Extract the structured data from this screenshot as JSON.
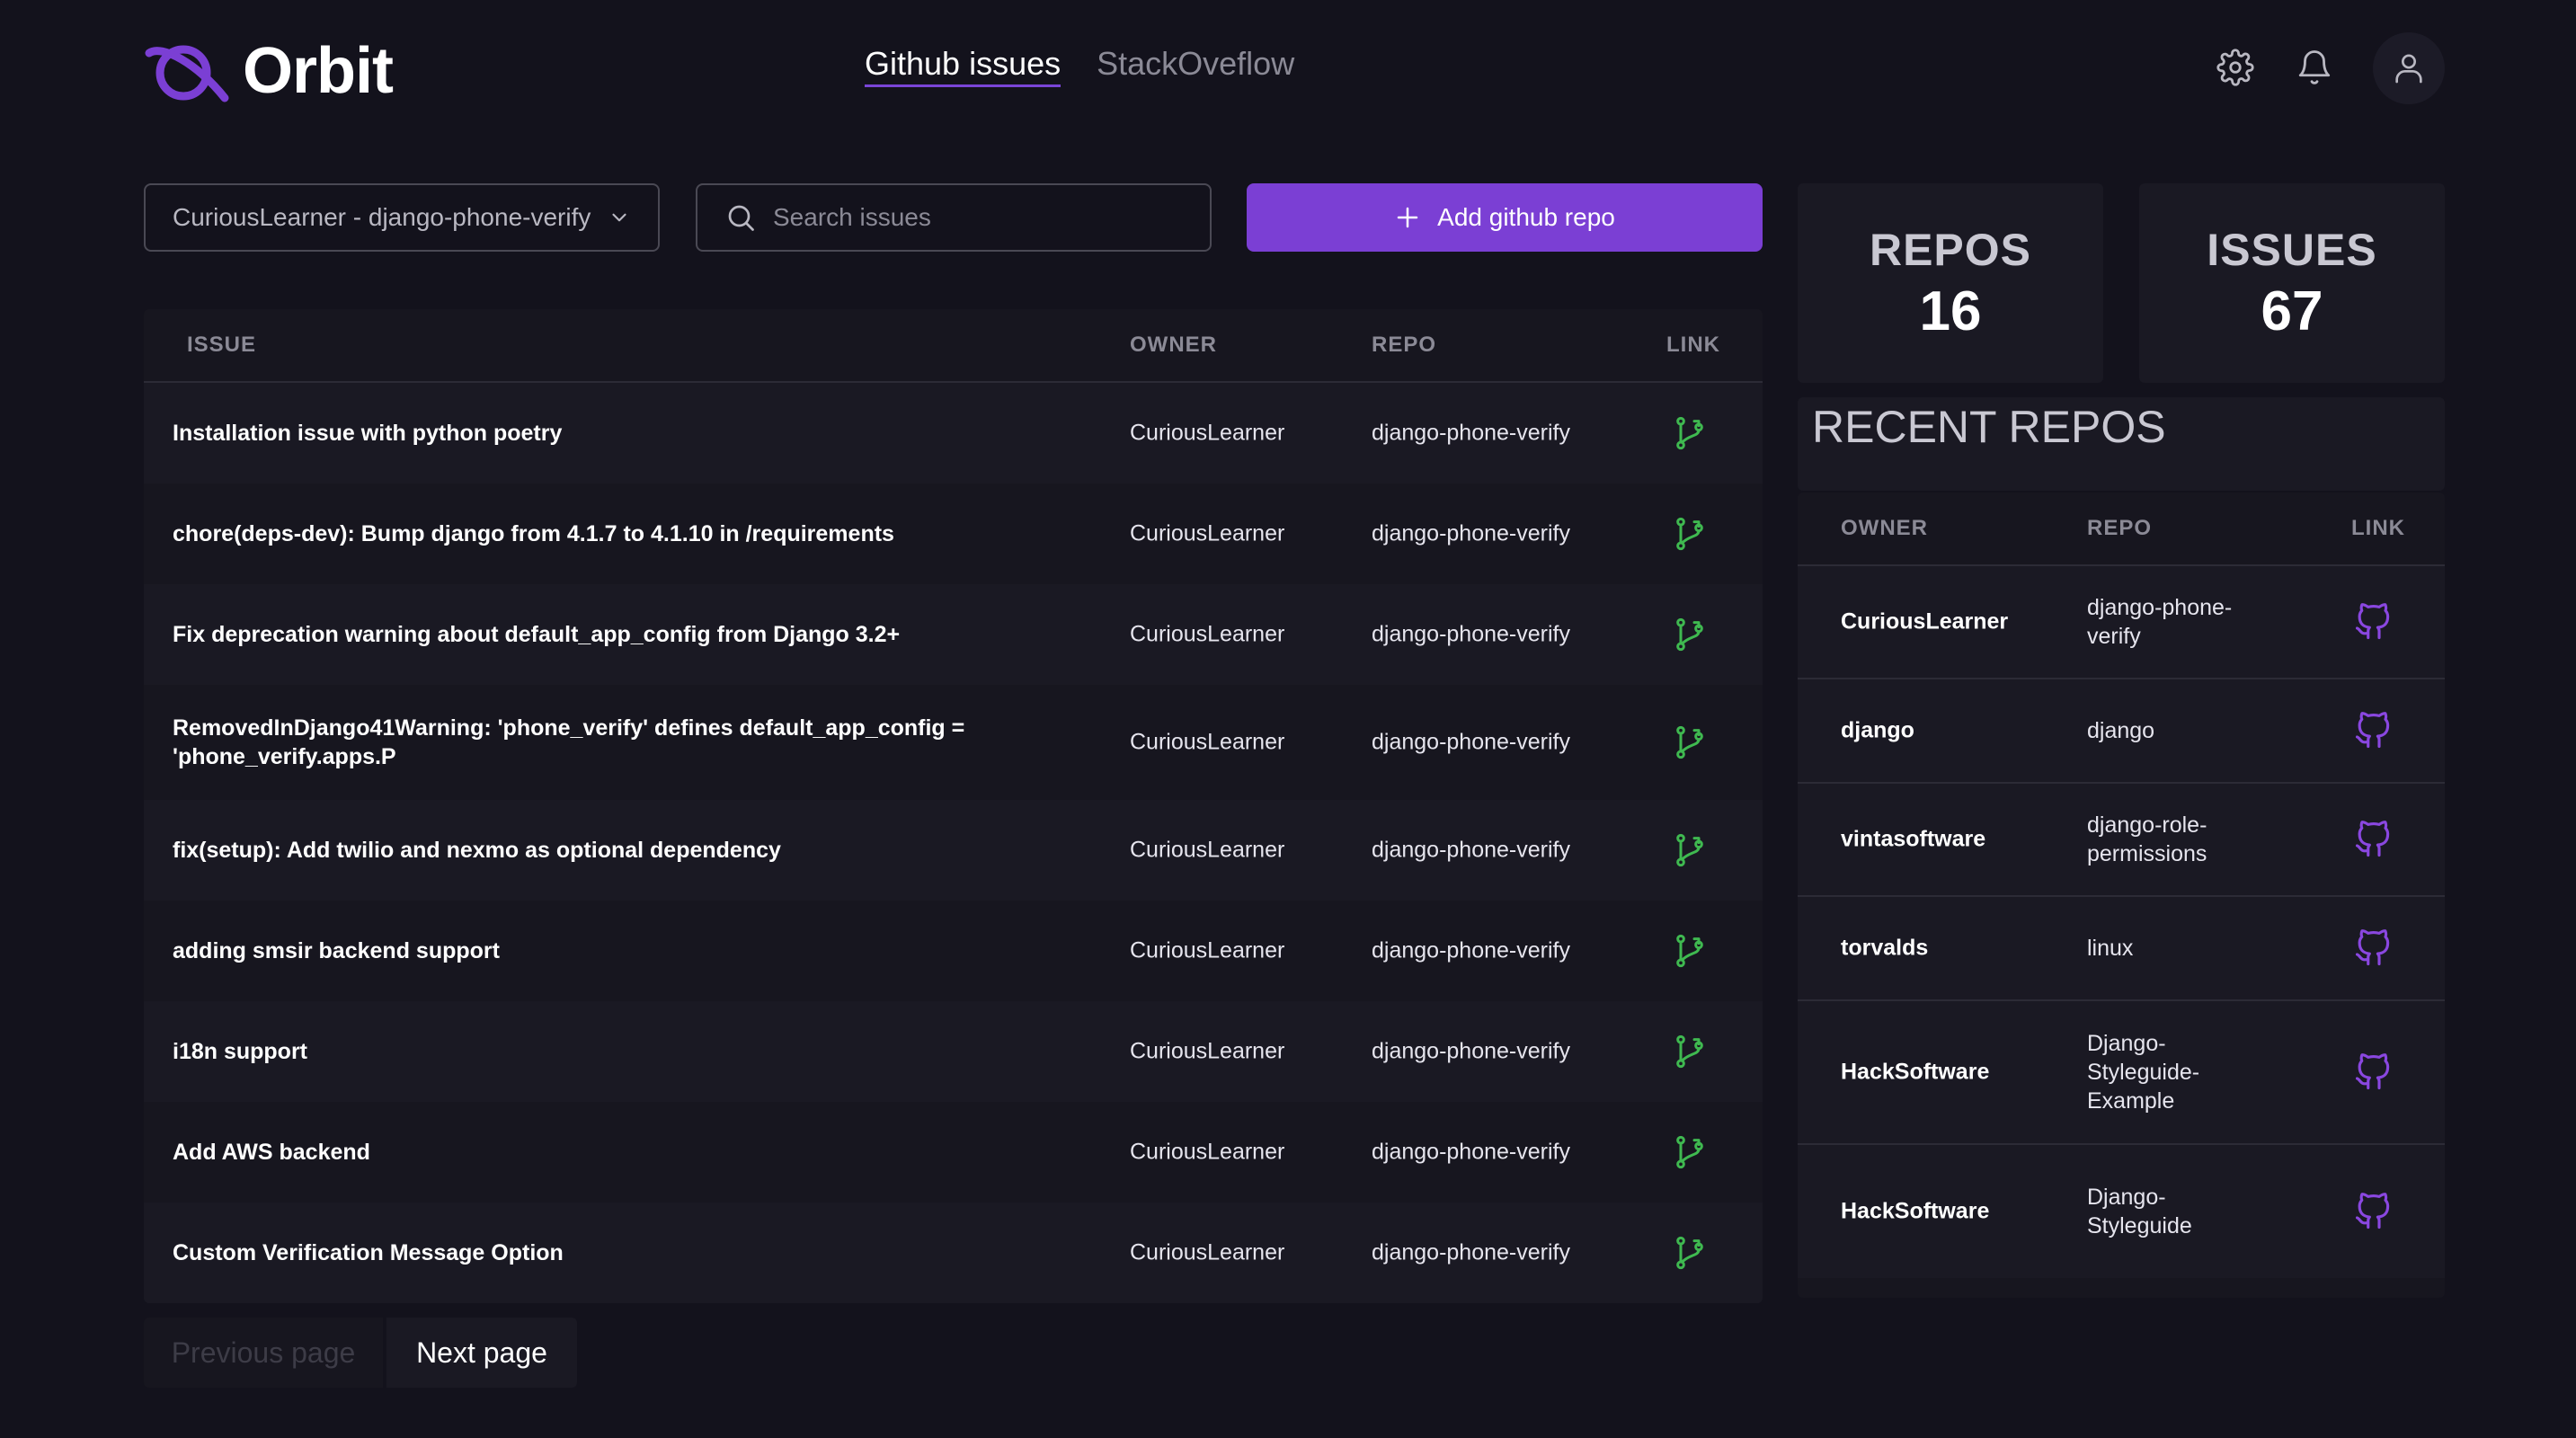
{
  "header": {
    "app_name": "Orbit",
    "nav": [
      {
        "label": "Github issues",
        "active": true
      },
      {
        "label": "StackOveflow",
        "active": false
      }
    ],
    "icons": [
      "settings-icon",
      "bell-icon",
      "user-icon"
    ]
  },
  "controls": {
    "repo_select_value": "CuriousLearner - django-phone-verify",
    "search_placeholder": "Search issues",
    "add_button_label": "Add github repo"
  },
  "issues_table": {
    "headers": {
      "issue": "ISSUE",
      "owner": "OWNER",
      "repo": "REPO",
      "link": "LINK"
    },
    "rows": [
      {
        "issue": "Installation issue with python poetry",
        "owner": "CuriousLearner",
        "repo": "django-phone-verify"
      },
      {
        "issue": "chore(deps-dev): Bump django from 4.1.7 to 4.1.10 in /requirements",
        "owner": "CuriousLearner",
        "repo": "django-phone-verify"
      },
      {
        "issue": "Fix deprecation warning about default_app_config from Django 3.2+",
        "owner": "CuriousLearner",
        "repo": "django-phone-verify"
      },
      {
        "issue": "RemovedInDjango41Warning: 'phone_verify' defines default_app_config = 'phone_verify.apps.P",
        "owner": "CuriousLearner",
        "repo": "django-phone-verify"
      },
      {
        "issue": "fix(setup): Add twilio and nexmo as optional dependency",
        "owner": "CuriousLearner",
        "repo": "django-phone-verify"
      },
      {
        "issue": "adding smsir backend support",
        "owner": "CuriousLearner",
        "repo": "django-phone-verify"
      },
      {
        "issue": "i18n support",
        "owner": "CuriousLearner",
        "repo": "django-phone-verify"
      },
      {
        "issue": "Add AWS backend",
        "owner": "CuriousLearner",
        "repo": "django-phone-verify"
      },
      {
        "issue": "Custom Verification Message Option",
        "owner": "CuriousLearner",
        "repo": "django-phone-verify"
      }
    ]
  },
  "pagination": {
    "prev_label": "Previous page",
    "next_label": "Next page"
  },
  "stats": {
    "repos_label": "REPOS",
    "repos_value": "16",
    "issues_label": "ISSUES",
    "issues_value": "67"
  },
  "recent_repos": {
    "title": "RECENT REPOS",
    "headers": {
      "owner": "OWNER",
      "repo": "REPO",
      "link": "LINK"
    },
    "rows": [
      {
        "owner": "CuriousLearner",
        "repo": "django-phone-verify"
      },
      {
        "owner": "django",
        "repo": "django"
      },
      {
        "owner": "vintasoftware",
        "repo": "django-role-permissions"
      },
      {
        "owner": "torvalds",
        "repo": "linux"
      },
      {
        "owner": "HackSoftware",
        "repo": "Django-Styleguide-Example"
      },
      {
        "owner": "HackSoftware",
        "repo": "Django-Styleguide"
      }
    ]
  },
  "colors": {
    "accent": "#7b3fd4",
    "branch_icon": "#3fb950",
    "github_icon": "#8a47e0",
    "background": "#13121c"
  }
}
